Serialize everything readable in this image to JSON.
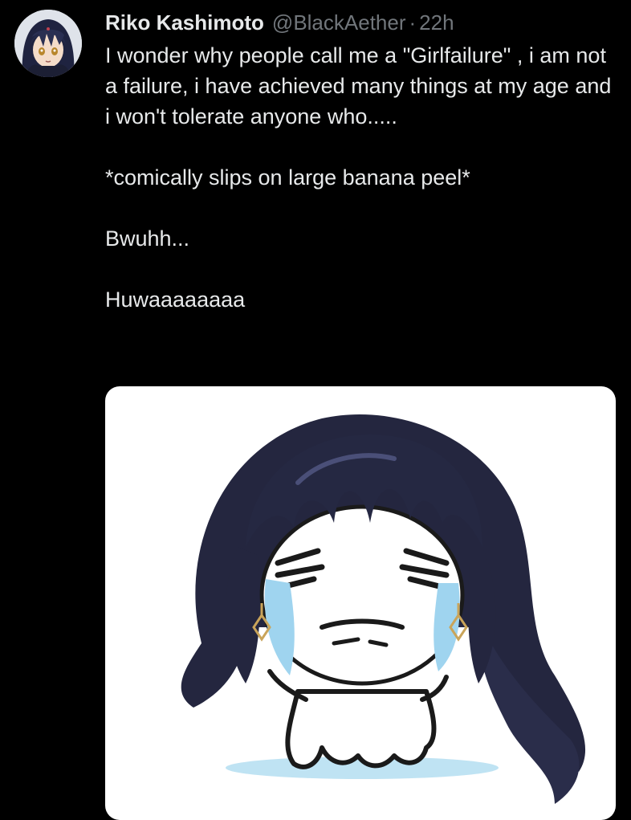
{
  "tweet": {
    "author_name": "Riko Kashimoto",
    "handle": "@BlackAether",
    "separator": "·",
    "time": "22h",
    "lines": [
      "I wonder why people call me a \"Girlfailure\" , i am not a failure, i have achieved many things at my age and i won't tolerate anyone who.....",
      "*comically slips on large banana peel*",
      "Bwuhh...",
      "Huwaaaaaaaa"
    ]
  },
  "icons": {
    "avatar": "avatar-anime-girl",
    "media": "crying-chibi-drawing"
  },
  "colors": {
    "background": "#000000",
    "primary_text": "#e7e9ea",
    "secondary_text": "#71767b",
    "hair": "#24263f"
  }
}
